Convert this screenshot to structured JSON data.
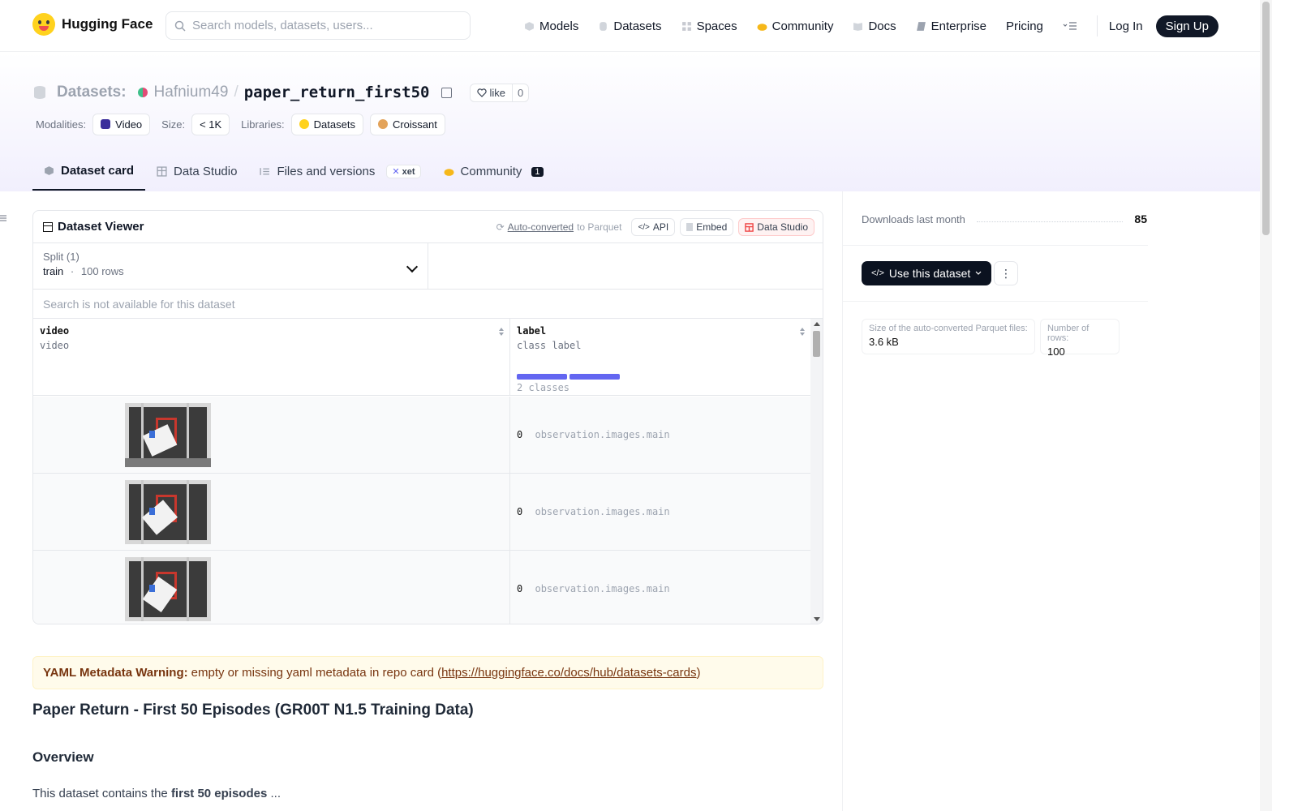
{
  "nav": {
    "brand": "Hugging Face",
    "search_placeholder": "Search models, datasets, users...",
    "links": [
      "Models",
      "Datasets",
      "Spaces",
      "Community",
      "Docs",
      "Enterprise",
      "Pricing"
    ],
    "login": "Log In",
    "signup": "Sign Up"
  },
  "repo": {
    "kind": "Datasets:",
    "owner": "Hafnium49",
    "separator": "/",
    "name": "paper_return_first50",
    "like_label": "like",
    "like_count": "0"
  },
  "meta": {
    "modalities_label": "Modalities:",
    "modality": "Video",
    "size_label": "Size:",
    "size": "< 1K",
    "libraries_label": "Libraries:",
    "libraries": [
      "Datasets",
      "Croissant"
    ]
  },
  "tabs": {
    "dataset_card": "Dataset card",
    "data_studio": "Data Studio",
    "files": "Files and versions",
    "xet": "xet",
    "community": "Community",
    "community_count": "1"
  },
  "viewer": {
    "title": "Dataset Viewer",
    "auto_converted": "Auto-converted",
    "to_parquet": "to Parquet",
    "api": "API",
    "embed": "Embed",
    "data_studio": "Data Studio",
    "split_label": "Split (1)",
    "split_name": "train",
    "split_dot": "·",
    "split_rows": "100 rows",
    "search_na": "Search is not available for this dataset",
    "columns": [
      {
        "name": "video",
        "type": "video"
      },
      {
        "name": "label",
        "type": "class label",
        "summary": "2 classes"
      }
    ],
    "class_fractions": [
      0.5,
      0.5
    ],
    "rows": [
      {
        "label_num": "0",
        "label_name": "observation.images.main"
      },
      {
        "label_num": "0",
        "label_name": "observation.images.main"
      },
      {
        "label_num": "0",
        "label_name": "observation.images.main"
      }
    ]
  },
  "card": {
    "warning_bold": "YAML Metadata Warning:",
    "warning_text": "empty or missing yaml metadata in repo card (",
    "warning_link": "https://huggingface.co/docs/hub/datasets-cards",
    "warning_close": ")",
    "title": "Paper Return - First 50 Episodes (GR00T N1.5 Training Data)",
    "overview": "Overview",
    "para_start": "This dataset contains the",
    "para_bold": "first 50 episodes",
    "para_end": "..."
  },
  "sidebar": {
    "downloads_label": "Downloads last month",
    "downloads": "85",
    "use_button": "Use this dataset",
    "parquet_size_label": "Size of the auto-converted Parquet files:",
    "parquet_size": "3.6 kB",
    "rows_label": "Number of rows:",
    "rows": "100"
  },
  "colors": {
    "accent": "#6366f1",
    "dark": "#111827",
    "warning_bg": "#fffbeb",
    "warning_text": "#78350f"
  }
}
